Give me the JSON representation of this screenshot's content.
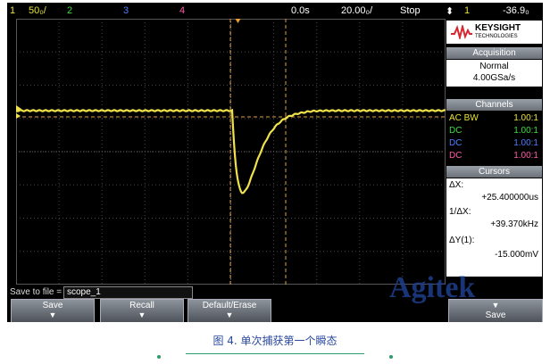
{
  "topbar": {
    "ch1": "1",
    "ch1_scale": "50₀/",
    "ch2": "2",
    "ch3": "3",
    "ch4": "4",
    "time_pos": "0.0s",
    "time_scale": "20.00₀/",
    "run_state": "Stop",
    "trig_icon": "⬍",
    "trig_src": "1",
    "trig_level": "-36.9₀"
  },
  "brand": {
    "name": "KEYSIGHT",
    "sub": "TECHNOLOGIES"
  },
  "acquisition": {
    "header": "Acquisition",
    "mode": "Normal",
    "rate": "4.00GSa/s"
  },
  "channels": {
    "header": "Channels",
    "items": [
      {
        "coupling": "AC BW",
        "probe": "1.00:1",
        "color": "#e8e23a"
      },
      {
        "coupling": "DC",
        "probe": "1.00:1",
        "color": "#3fdc3f"
      },
      {
        "coupling": "DC",
        "probe": "1.00:1",
        "color": "#4f7dff"
      },
      {
        "coupling": "DC",
        "probe": "1.00:1",
        "color": "#ff5aa8"
      }
    ]
  },
  "cursors": {
    "header": "Cursors",
    "dx_label": "ΔX:",
    "dx_value": "+25.400000us",
    "inv_label": "1/ΔX:",
    "inv_value": "+39.370kHz",
    "dy_label": "ΔY(1):",
    "dy_value": "-15.000mV"
  },
  "save": {
    "label": "Save to file =",
    "filename": "scope_1"
  },
  "softkeys": [
    {
      "label": "Save"
    },
    {
      "label": "Recall"
    },
    {
      "label": "Default/Erase"
    },
    {
      "label": "Save"
    }
  ],
  "softkey_arrow": "▼",
  "watermark": "Agitek",
  "caption": "图 4. 单次捕获第一个瞬态",
  "colors": {
    "trace": "#f0e24a",
    "cursor": "#e0a040",
    "grid": "#444444"
  }
}
